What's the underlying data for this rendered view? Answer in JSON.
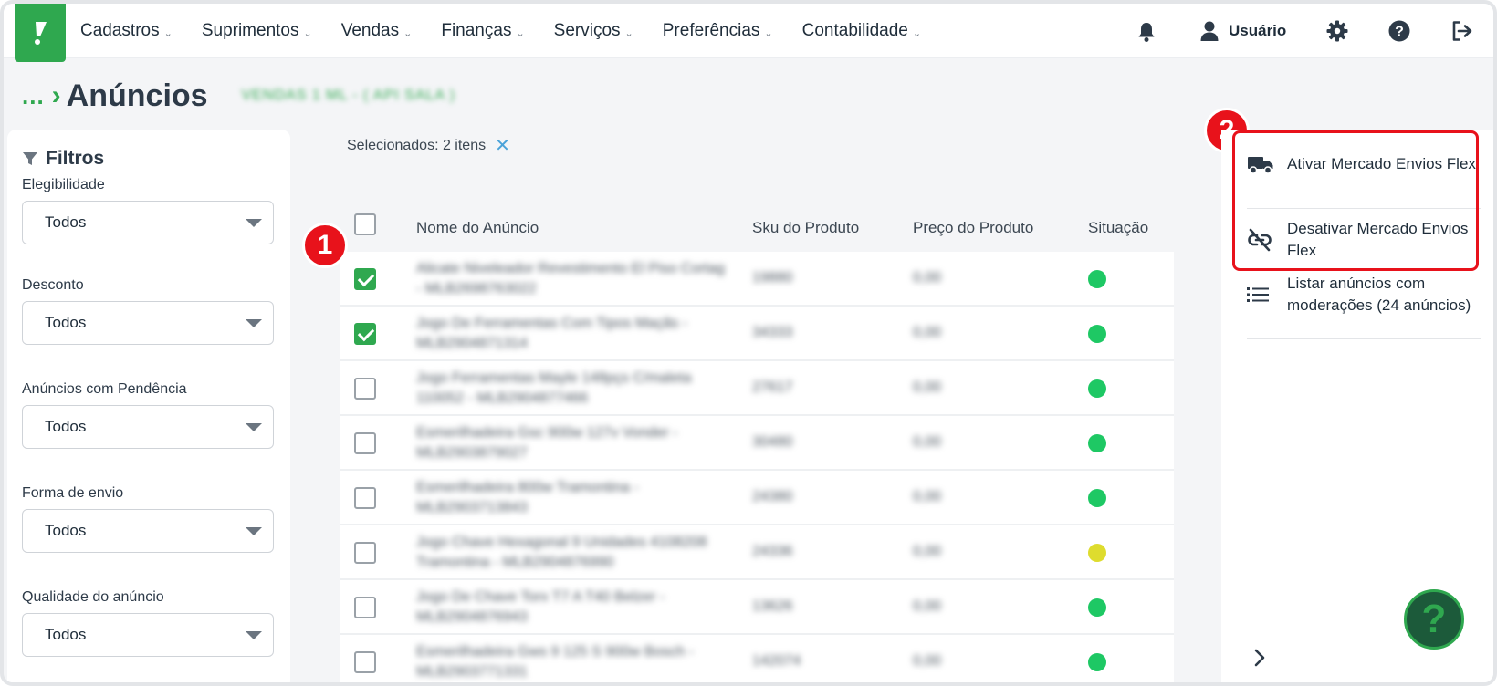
{
  "nav": {
    "items": [
      {
        "label": "Cadastros"
      },
      {
        "label": "Suprimentos"
      },
      {
        "label": "Vendas"
      },
      {
        "label": "Finanças"
      },
      {
        "label": "Serviços"
      },
      {
        "label": "Preferências"
      },
      {
        "label": "Contabilidade"
      }
    ],
    "user_label": "Usuário"
  },
  "breadcrumb": {
    "ellipsis": "...",
    "title": "Anúncios",
    "account": "VENDAS 1 ML - ( API SALA )"
  },
  "filters": {
    "title": "Filtros",
    "groups": [
      {
        "label": "Elegibilidade",
        "value": "Todos"
      },
      {
        "label": "Desconto",
        "value": "Todos"
      },
      {
        "label": "Anúncios com Pendência",
        "value": "Todos"
      },
      {
        "label": "Forma de envio",
        "value": "Todos"
      },
      {
        "label": "Qualidade do anúncio",
        "value": "Todos"
      }
    ]
  },
  "selection": {
    "text": "Selecionados: 2 itens",
    "clear": "✕"
  },
  "table": {
    "headers": {
      "name": "Nome do Anúncio",
      "sku": "Sku do Produto",
      "price": "Preço do Produto",
      "status": "Situação"
    },
    "rows": [
      {
        "checked": true,
        "name": "Alicate Niveleador Revestimento El Piso Cortag - MLB2698763022",
        "sku": "19880",
        "price": "0,00",
        "status_color": "#1ec864"
      },
      {
        "checked": true,
        "name": "Jogo De Ferramentas Com Tipos Maçãs - MLB2904871314",
        "sku": "34333",
        "price": "0,00",
        "status_color": "#1ec864"
      },
      {
        "checked": false,
        "name": "Jogo Ferramentas Mayle 148pçs C/maleta 110052 - MLB2904877466",
        "sku": "27617",
        "price": "0,00",
        "status_color": "#1ec864"
      },
      {
        "checked": false,
        "name": "Esmerilhadeira Gsc 900w 127v Vonder - MLB2903879027",
        "sku": "30480",
        "price": "0,00",
        "status_color": "#1ec864"
      },
      {
        "checked": false,
        "name": "Esmerilhadeira 800w Tramontina - MLB2903713843",
        "sku": "24380",
        "price": "0,00",
        "status_color": "#1ec864"
      },
      {
        "checked": false,
        "name": "Jogo Chave Hexagonal 9 Unidades 4108208 Tramontina - MLB2904876990",
        "sku": "24336",
        "price": "0,00",
        "status_color": "#dedc2e"
      },
      {
        "checked": false,
        "name": "Jogo De Chave Torx T7 A T40 Belzer - MLB2904876943",
        "sku": "13626",
        "price": "0,00",
        "status_color": "#1ec864"
      },
      {
        "checked": false,
        "name": "Esmerilhadeira Gws 9 125 S 900w Bosch - MLB2903771331",
        "sku": "142074",
        "price": "0,00",
        "status_color": "#1ec864"
      }
    ]
  },
  "badges": {
    "one": "1",
    "two": "2"
  },
  "actions": [
    {
      "label": "Ativar Mercado Envios Flex",
      "icon": "truck-icon"
    },
    {
      "label": "Desativar Mercado Envios Flex",
      "icon": "unlink-icon"
    },
    {
      "label": "Listar anúncios com moderações (24 anúncios)",
      "icon": "list-icon"
    }
  ],
  "help_fab": "?",
  "colors": {
    "brand": "#2fa84f",
    "highlight": "#e8121b",
    "active_status": "#1ec864",
    "warning_status": "#dedc2e"
  }
}
